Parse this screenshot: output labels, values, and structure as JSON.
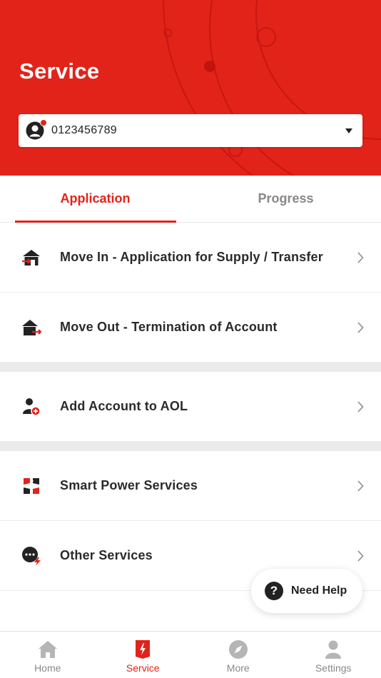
{
  "header": {
    "title": "Service"
  },
  "account": {
    "number": "0123456789"
  },
  "tabs": [
    {
      "label": "Application",
      "active": true
    },
    {
      "label": "Progress",
      "active": false
    }
  ],
  "list": {
    "move_in": "Move In - Application for Supply / Transfer",
    "move_out": "Move Out - Termination of Account",
    "add_account": "Add Account to AOL",
    "smart_power": "Smart Power Services",
    "other_services": "Other Services"
  },
  "help": {
    "label": "Need Help"
  },
  "nav": [
    {
      "label": "Home",
      "icon": "home-icon"
    },
    {
      "label": "Service",
      "icon": "service-icon",
      "active": true
    },
    {
      "label": "More",
      "icon": "compass-icon"
    },
    {
      "label": "Settings",
      "icon": "person-icon"
    }
  ],
  "colors": {
    "brand": "#e2231a",
    "text": "#222222",
    "muted": "#888888"
  }
}
